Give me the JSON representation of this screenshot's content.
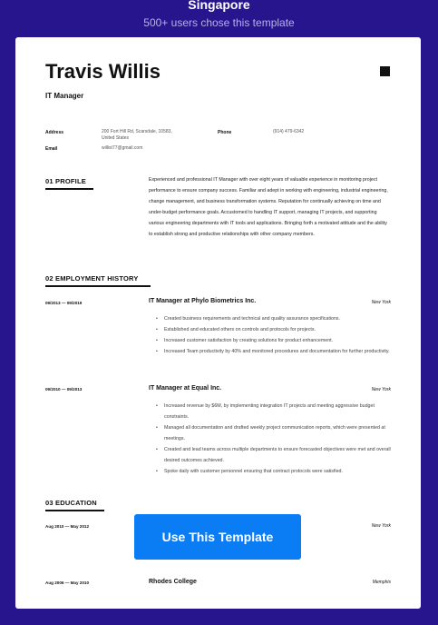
{
  "header": {
    "title": "Singapore",
    "subtitle": "500+ users chose this template"
  },
  "resume": {
    "name": "Travis Willis",
    "role": "IT Manager",
    "contact": {
      "address_label": "Address",
      "address_line1": "200 Fort Hill Rd, Scarsdale, 10583,",
      "address_line2": "United States",
      "phone_label": "Phone",
      "phone_value": "(914) 479-6342",
      "email_label": "Email",
      "email_value": "willist77@gmail.com"
    },
    "profile": {
      "heading": "01  PROFILE",
      "text": "Experienced and professional IT Manager with over eight years of valuable experience in monitoring project performance to ensure company success. Familiar and adept in working with engineering, industrial engineering, change management, and business transformation systems. Reputation for continually achieving on time and under-budget performance goals. Accustomed to handling IT support, managing IT projects, and supporting various engineering departments with IT tools and applications. Bringing forth a motivated attitude and the ability to establish strong and productive relationships with other company members."
    },
    "employment": {
      "heading": "02  EMPLOYMENT HISTORY",
      "jobs": [
        {
          "dates": "09/2013 — 09/2019",
          "title": "IT Manager at  Phylo Biometrics Inc.",
          "city": "New York",
          "bullets": [
            "Created business requirements and technical and quality assurance specifications.",
            "Established and educated others on controls and protocols for projects.",
            "Increased customer satisfaction by creating solutions for product enhancement.",
            "Increased Team productivity by 40% and monitored procedures and documentation for further productivity."
          ]
        },
        {
          "dates": "09/2010 — 09/2013",
          "title": "IT Manager at  Equal Inc.",
          "city": "New York",
          "bullets": [
            "Increased revenue by $6M, by implementing integration IT projects and meeting aggressive budget constraints.",
            "Managed all documentation and drafted weekly project communication reports, which were presented at meetings.",
            "Created and lead teams across multiple departments to ensure forecasted objectives were met and overall desired outcomes achieved.",
            "Spoke daily with customer personnel ensuring that contract protocols were satisfied."
          ]
        }
      ]
    },
    "education": {
      "heading": "03  EDUCATION",
      "entries": [
        {
          "dates": "Aug 2010 — May 2012",
          "school": "",
          "city": "New York"
        },
        {
          "dates": "Aug 2006 — May 2010",
          "school": "Rhodes College",
          "city": "Memphis"
        }
      ]
    }
  },
  "cta": {
    "label": "Use This Template"
  }
}
